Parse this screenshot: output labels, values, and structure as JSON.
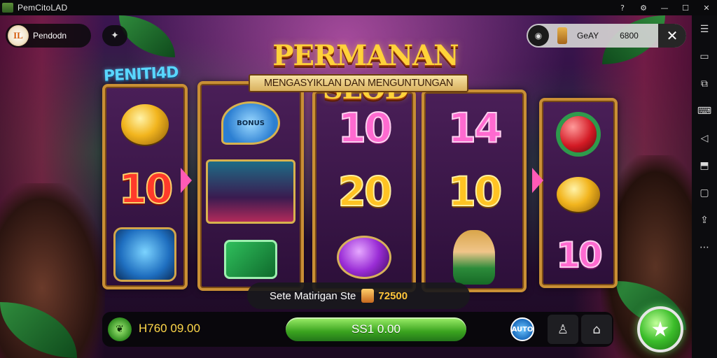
{
  "window": {
    "title": "PemCitoLAD",
    "controls": [
      "?",
      "⚙",
      "—",
      "☐",
      "✕"
    ]
  },
  "sidebar": {
    "icons": [
      "menu-icon",
      "window-icon",
      "external-icon",
      "keyboard-icon",
      "back-icon",
      "screenshot-icon",
      "folder-icon",
      "apk-icon",
      "more-icon"
    ]
  },
  "hud": {
    "player_avatar_text": "IL",
    "player_name": "Pendodn",
    "bonus_icon": "gift-icon",
    "balance_label": "GeAY",
    "balance_value": "6800",
    "close_symbol": "✕"
  },
  "game": {
    "logo": "PENITI4D",
    "title": "PERMANAN SLOD",
    "subtitle": "MENGASYIKLAN DAN MENGUNTUNGAN"
  },
  "reels": [
    {
      "symbols": [
        {
          "type": "coin"
        },
        {
          "type": "number",
          "text": "10",
          "color": "red"
        },
        {
          "type": "face"
        }
      ]
    },
    {
      "symbols": [
        {
          "type": "racket",
          "text": "BONUS"
        },
        {
          "type": "lady"
        },
        {
          "type": "pad"
        }
      ]
    },
    {
      "symbols": [
        {
          "type": "number",
          "text": "10",
          "color": "pink"
        },
        {
          "type": "number",
          "text": "20",
          "color": "gold"
        },
        {
          "type": "purple"
        }
      ]
    },
    {
      "symbols": [
        {
          "type": "number",
          "text": "14",
          "color": "pink"
        },
        {
          "type": "number",
          "text": "10",
          "color": "gold"
        },
        {
          "type": "elf"
        }
      ]
    },
    {
      "symbols": [
        {
          "type": "gem"
        },
        {
          "type": "coin"
        },
        {
          "type": "number",
          "text": "10",
          "color": "pink"
        }
      ]
    }
  ],
  "win": {
    "label": "Sete Matirigan Ste",
    "value": "72500"
  },
  "controls": {
    "balance": "H760 09.00",
    "bet_button": "SS1 0.00",
    "auto_label": "AUTO",
    "user_icon": "user-icon",
    "home_icon": "home-icon",
    "spin_icon": "spin-icon"
  }
}
